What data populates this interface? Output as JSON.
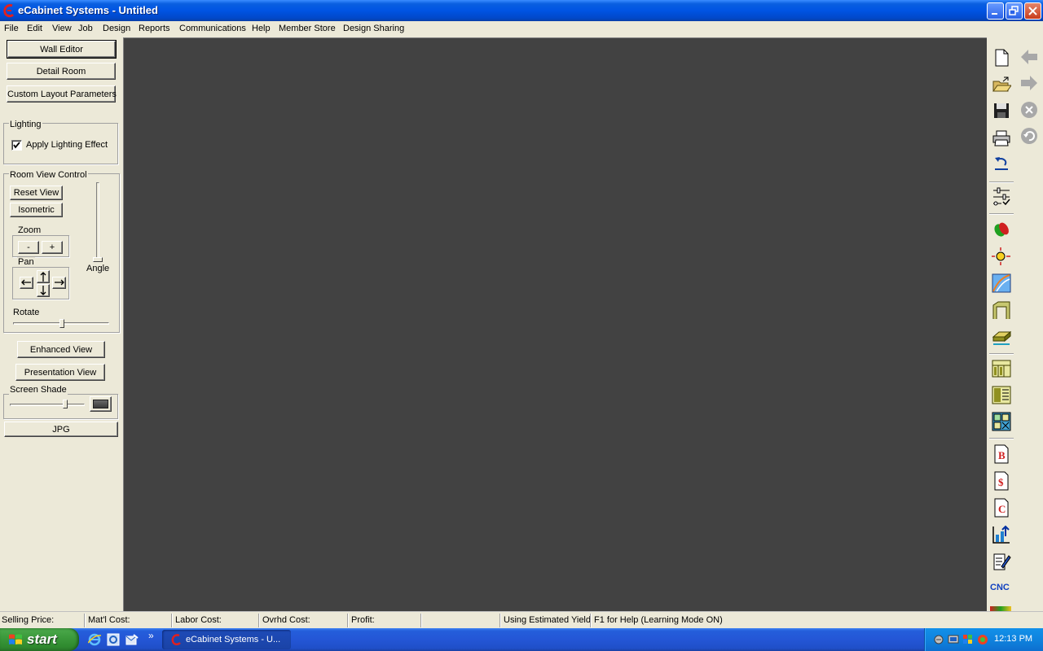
{
  "window": {
    "title": "eCabinet Systems - Untitled"
  },
  "menu": [
    "File",
    "Edit",
    "View",
    "Job",
    "Design",
    "Reports",
    "Communications",
    "Help",
    "Member Store",
    "Design Sharing"
  ],
  "left_panel": {
    "wall_editor": "Wall Editor",
    "detail_room": "Detail Room",
    "custom_layout": "Custom Layout Parameters",
    "lighting_group": "Lighting",
    "apply_lighting": "Apply Lighting Effect",
    "apply_lighting_checked": true,
    "room_view_group": "Room View Control",
    "reset_view": "Reset View",
    "isometric": "Isometric",
    "zoom_group": "Zoom",
    "zoom_out": "-",
    "zoom_in": "+",
    "pan_group": "Pan",
    "angle_label": "Angle",
    "rotate_label": "Rotate",
    "enhanced_view": "Enhanced View",
    "presentation_view": "Presentation View",
    "screen_shade_group": "Screen Shade",
    "jpg": "JPG"
  },
  "right_toolbar": {
    "cnc_label": "CNC",
    "b_label": "B",
    "dollar_label": "$",
    "c_label": "C"
  },
  "status_bar": {
    "selling_price": "Selling Price:",
    "matl_cost": "Mat'l Cost:",
    "labor_cost": "Labor Cost:",
    "ovrhd_cost": "Ovrhd Cost:",
    "profit": "Profit:",
    "blank": "",
    "yield": "Using Estimated Yield",
    "help": "F1 for Help (Learning Mode ON)"
  },
  "taskbar": {
    "start": "start",
    "task_item": "eCabinet Systems - U...",
    "clock": "12:13 PM",
    "chevron": "»"
  },
  "colors": {
    "viewport_bg": "#424242",
    "panel_bg": "#ece9d8",
    "title_blue": "#0054e3",
    "taskbar_blue": "#245edb",
    "start_green": "#3c9a3c"
  }
}
